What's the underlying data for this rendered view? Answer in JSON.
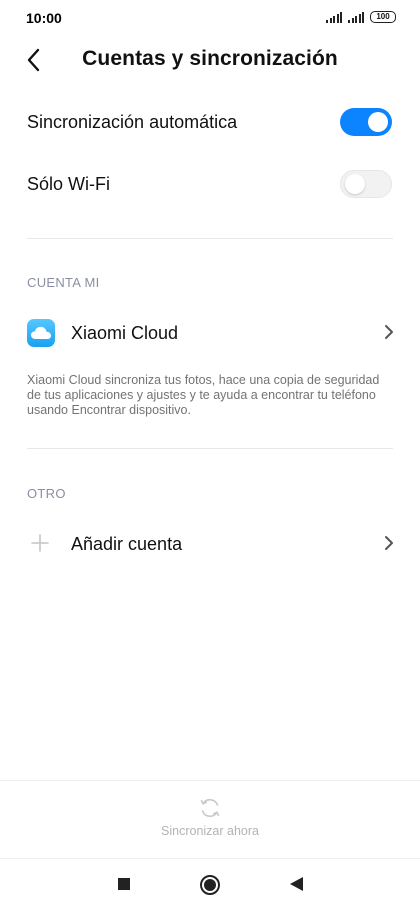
{
  "status_bar": {
    "time": "10:00",
    "battery": "100"
  },
  "header": {
    "title": "Cuentas y sincronización"
  },
  "settings": {
    "auto_sync": {
      "label": "Sincronización automática",
      "enabled": true
    },
    "wifi_only": {
      "label": "Sólo Wi-Fi",
      "enabled": false
    }
  },
  "mi_account": {
    "section_title": "CUENTA MI",
    "cloud_label": "Xiaomi Cloud",
    "description": "Xiaomi Cloud sincroniza tus fotos, hace una copia de seguridad de tus aplicaciones y ajustes y te ayuda a encontrar tu teléfono usando Encontrar dispositivo."
  },
  "other": {
    "section_title": "OTRO",
    "add_account_label": "Añadir cuenta"
  },
  "bottom": {
    "sync_now_label": "Sincronizar ahora"
  },
  "colors": {
    "accent": "#0d84ff",
    "section_header": "#8a8fa3",
    "muted": "#b3b3b3"
  }
}
